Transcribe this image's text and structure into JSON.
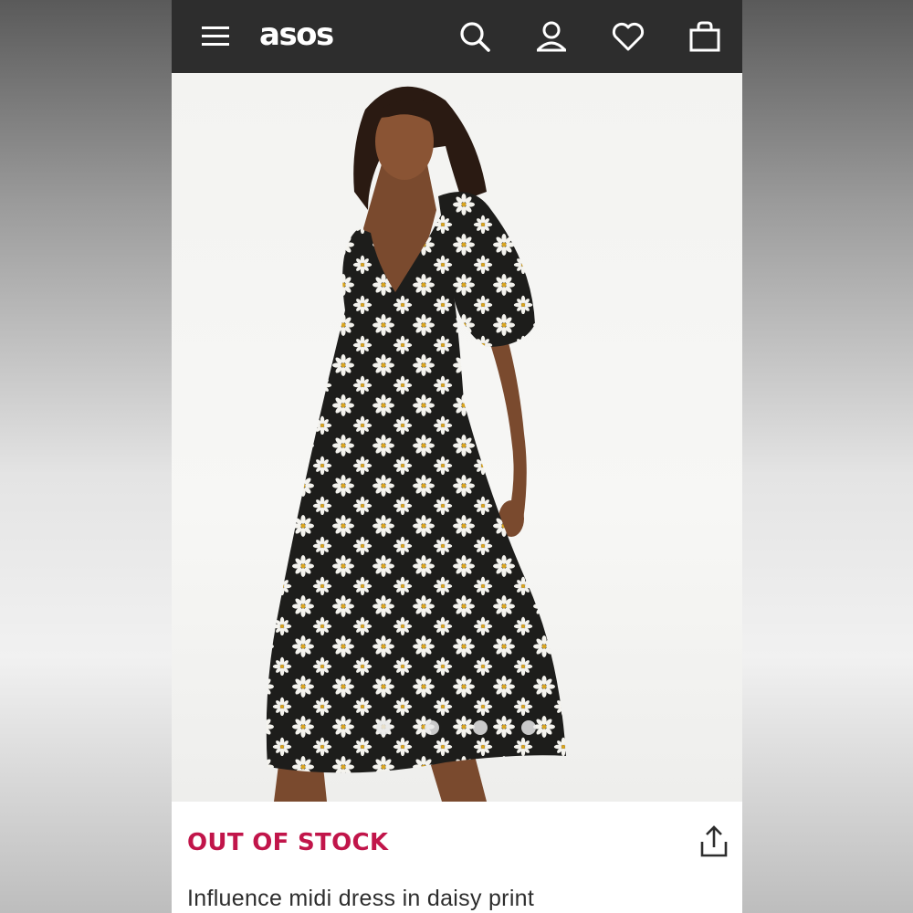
{
  "header": {
    "logo": "asos",
    "icons": {
      "menu": "hamburger-menu-icon",
      "search": "search-icon",
      "account": "account-icon",
      "saved": "heart-icon",
      "bag": "bag-icon"
    },
    "background_color": "#2d2d2d"
  },
  "product": {
    "image": "model-wearing-black-daisy-print-midi-dress",
    "stock_status": "OUT OF STOCK",
    "stock_color": "#c1154a",
    "share_icon": "share-icon",
    "name": "Influence midi dress in daisy print"
  }
}
